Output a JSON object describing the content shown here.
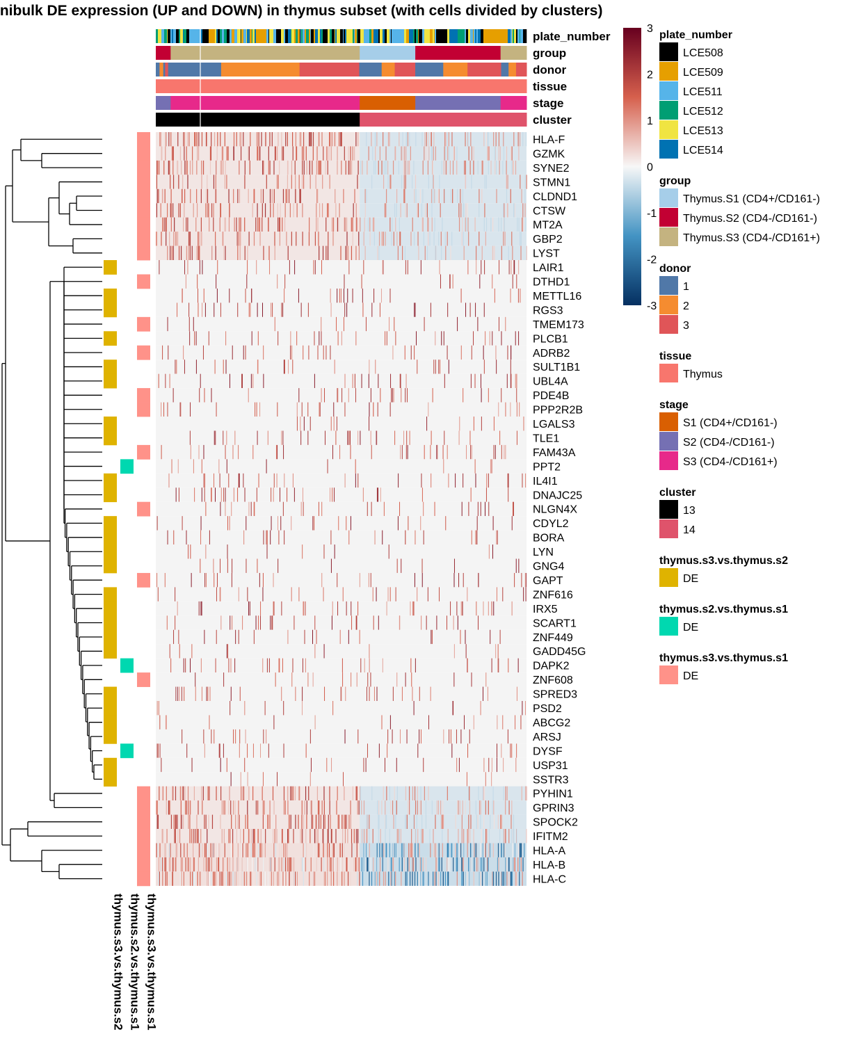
{
  "chart_data": {
    "type": "heatmap",
    "title": "inibulk DE expression (UP and DOWN) in thymus subset (with cells divided by clusters)",
    "genes": [
      "HLA-F",
      "GZMK",
      "SYNE2",
      "STMN1",
      "CLDND1",
      "CTSW",
      "MT2A",
      "GBP2",
      "LYST",
      "LAIR1",
      "DTHD1",
      "METTL16",
      "RGS3",
      "TMEM173",
      "PLCB1",
      "ADRB2",
      "SULT1B1",
      "UBL4A",
      "PDE4B",
      "PPP2R2B",
      "LGALS3",
      "TLE1",
      "FAM43A",
      "PPT2",
      "IL4I1",
      "DNAJC25",
      "NLGN4X",
      "CDYL2",
      "BORA",
      "LYN",
      "GNG4",
      "GAPT",
      "ZNF616",
      "IRX5",
      "SCART1",
      "ZNF449",
      "GADD45G",
      "DAPK2",
      "ZNF608",
      "SPRED3",
      "PSD2",
      "ABCG2",
      "ARSJ",
      "DYSF",
      "USP31",
      "SSTR3",
      "PYHIN1",
      "GPRIN3",
      "SPOCK2",
      "IFITM2",
      "HLA-A",
      "HLA-B",
      "HLA-C"
    ],
    "gene_profile": {
      "HLA-F": 0.45,
      "GZMK": 0.4,
      "SYNE2": 0.45,
      "STMN1": 0.2,
      "CLDND1": 0.3,
      "CTSW": 0.3,
      "MT2A": 0.35,
      "GBP2": 0.3,
      "LYST": 0.25,
      "PYHIN1": 0.3,
      "GPRIN3": 0.35,
      "SPOCK2": 0.4,
      "IFITM2": 0.5,
      "HLA-A": 0.7,
      "HLA-B": 0.75,
      "HLA-C": 0.7
    },
    "color_scale": {
      "type": "continuous",
      "min": -3,
      "max": 3,
      "breaks": [
        3,
        2,
        1,
        0,
        -1,
        -2,
        -3
      ],
      "colors": {
        "low": "#053061",
        "mid_low": "#4393c3",
        "mid": "#f7f7f7",
        "mid_high": "#d6604d",
        "high": "#67001f"
      }
    },
    "column_split": [
      "cluster 13",
      "cluster 14"
    ],
    "top_annotations": {
      "labels": [
        "plate_number",
        "group",
        "donor",
        "tissue",
        "stage",
        "cluster"
      ],
      "group_segments": [
        {
          "value": "Thymus.S2 (CD4-/CD161-)",
          "frac": 0.04
        },
        {
          "value": "Thymus.S3 (CD4-/CD161+)",
          "frac": 0.51
        },
        {
          "value": "Thymus.S1 (CD4+/CD161-)",
          "frac": 0.15
        },
        {
          "value": "Thymus.S2 (CD4-/CD161-)",
          "frac": 0.23
        },
        {
          "value": "Thymus.S3 (CD4-/CD161+)",
          "frac": 0.07
        }
      ],
      "donor_segments": [
        {
          "value": "1",
          "frac": 0.01
        },
        {
          "value": "2",
          "frac": 0.01
        },
        {
          "value": "1",
          "frac": 0.005
        },
        {
          "value": "3",
          "frac": 0.008
        },
        {
          "value": "1",
          "frac": 0.142
        },
        {
          "value": "2",
          "frac": 0.21
        },
        {
          "value": "3",
          "frac": 0.16
        },
        {
          "value": "1",
          "frac": 0.06
        },
        {
          "value": "2",
          "frac": 0.035
        },
        {
          "value": "3",
          "frac": 0.055
        },
        {
          "value": "1",
          "frac": 0.075
        },
        {
          "value": "2",
          "frac": 0.065
        },
        {
          "value": "3",
          "frac": 0.09
        },
        {
          "value": "1",
          "frac": 0.02
        },
        {
          "value": "2",
          "frac": 0.02
        },
        {
          "value": "3",
          "frac": 0.028
        }
      ],
      "stage_segments": [
        {
          "value": "S2 (CD4-/CD161-)",
          "frac": 0.04
        },
        {
          "value": "S3 (CD4-/CD161+)",
          "frac": 0.51
        },
        {
          "value": "S1 (CD4+/CD161-)",
          "frac": 0.15
        },
        {
          "value": "S2 (CD4-/CD161-)",
          "frac": 0.23
        },
        {
          "value": "S3 (CD4-/CD161+)",
          "frac": 0.07
        }
      ],
      "cluster_segments": [
        {
          "value": "13",
          "frac": 0.55
        },
        {
          "value": "14",
          "frac": 0.45
        }
      ],
      "tissue_segments": [
        {
          "value": "Thymus",
          "frac": 1.0
        }
      ]
    },
    "row_annotations": {
      "labels": [
        "thymus.s3.vs.thymus.s2",
        "thymus.s2.vs.thymus.s1",
        "thymus.s3.vs.thymus.s1"
      ],
      "thymus.s3.vs.thymus.s2": [
        "LAIR1",
        "METTL16",
        "RGS3",
        "PLCB1",
        "SULT1B1",
        "UBL4A",
        "LGALS3",
        "TLE1",
        "IL4I1",
        "DNAJC25",
        "CDYL2",
        "BORA",
        "LYN",
        "GNG4",
        "ZNF616",
        "IRX5",
        "SCART1",
        "ZNF449",
        "GADD45G",
        "SPRED3",
        "PSD2",
        "ABCG2",
        "ARSJ",
        "USP31",
        "SSTR3"
      ],
      "thymus.s2.vs.thymus.s1": [
        "PPT2",
        "DAPK2",
        "DYSF"
      ],
      "thymus.s3.vs.thymus.s1": [
        "HLA-F",
        "GZMK",
        "SYNE2",
        "STMN1",
        "CLDND1",
        "CTSW",
        "MT2A",
        "GBP2",
        "LYST",
        "DTHD1",
        "TMEM173",
        "ADRB2",
        "PDE4B",
        "PPP2R2B",
        "FAM43A",
        "NLGN4X",
        "GAPT",
        "ZNF608",
        "PYHIN1",
        "GPRIN3",
        "SPOCK2",
        "IFITM2",
        "HLA-A",
        "HLA-B",
        "HLA-C"
      ]
    },
    "legends": [
      {
        "title": "plate_number",
        "items": [
          {
            "label": "LCE508",
            "color": "#000000"
          },
          {
            "label": "LCE509",
            "color": "#E69F00"
          },
          {
            "label": "LCE511",
            "color": "#56B4E9"
          },
          {
            "label": "LCE512",
            "color": "#009E73"
          },
          {
            "label": "LCE513",
            "color": "#F0E442"
          },
          {
            "label": "LCE514",
            "color": "#0072B2"
          }
        ]
      },
      {
        "title": "group",
        "items": [
          {
            "label": "Thymus.S1 (CD4+/CD161-)",
            "color": "#A6CEE9"
          },
          {
            "label": "Thymus.S2 (CD4-/CD161-)",
            "color": "#C20033"
          },
          {
            "label": "Thymus.S3 (CD4-/CD161+)",
            "color": "#C4B380"
          }
        ]
      },
      {
        "title": "donor",
        "items": [
          {
            "label": "1",
            "color": "#5078A8"
          },
          {
            "label": "2",
            "color": "#F58C30"
          },
          {
            "label": "3",
            "color": "#E05558"
          }
        ]
      },
      {
        "title": "tissue",
        "items": [
          {
            "label": "Thymus",
            "color": "#F8766D"
          }
        ]
      },
      {
        "title": "stage",
        "items": [
          {
            "label": "S1 (CD4+/CD161-)",
            "color": "#D95F02"
          },
          {
            "label": "S2 (CD4-/CD161-)",
            "color": "#7570B3"
          },
          {
            "label": "S3 (CD4-/CD161+)",
            "color": "#E7298A"
          }
        ]
      },
      {
        "title": "cluster",
        "items": [
          {
            "label": "13",
            "color": "#000000"
          },
          {
            "label": "14",
            "color": "#DF536B"
          }
        ]
      },
      {
        "title": "thymus.s3.vs.thymus.s2",
        "items": [
          {
            "label": "DE",
            "color": "#DFB300"
          }
        ]
      },
      {
        "title": "thymus.s2.vs.thymus.s1",
        "items": [
          {
            "label": "DE",
            "color": "#00D8B0"
          }
        ]
      },
      {
        "title": "thymus.s3.vs.thymus.s1",
        "items": [
          {
            "label": "DE",
            "color": "#FF9289"
          }
        ]
      }
    ]
  }
}
